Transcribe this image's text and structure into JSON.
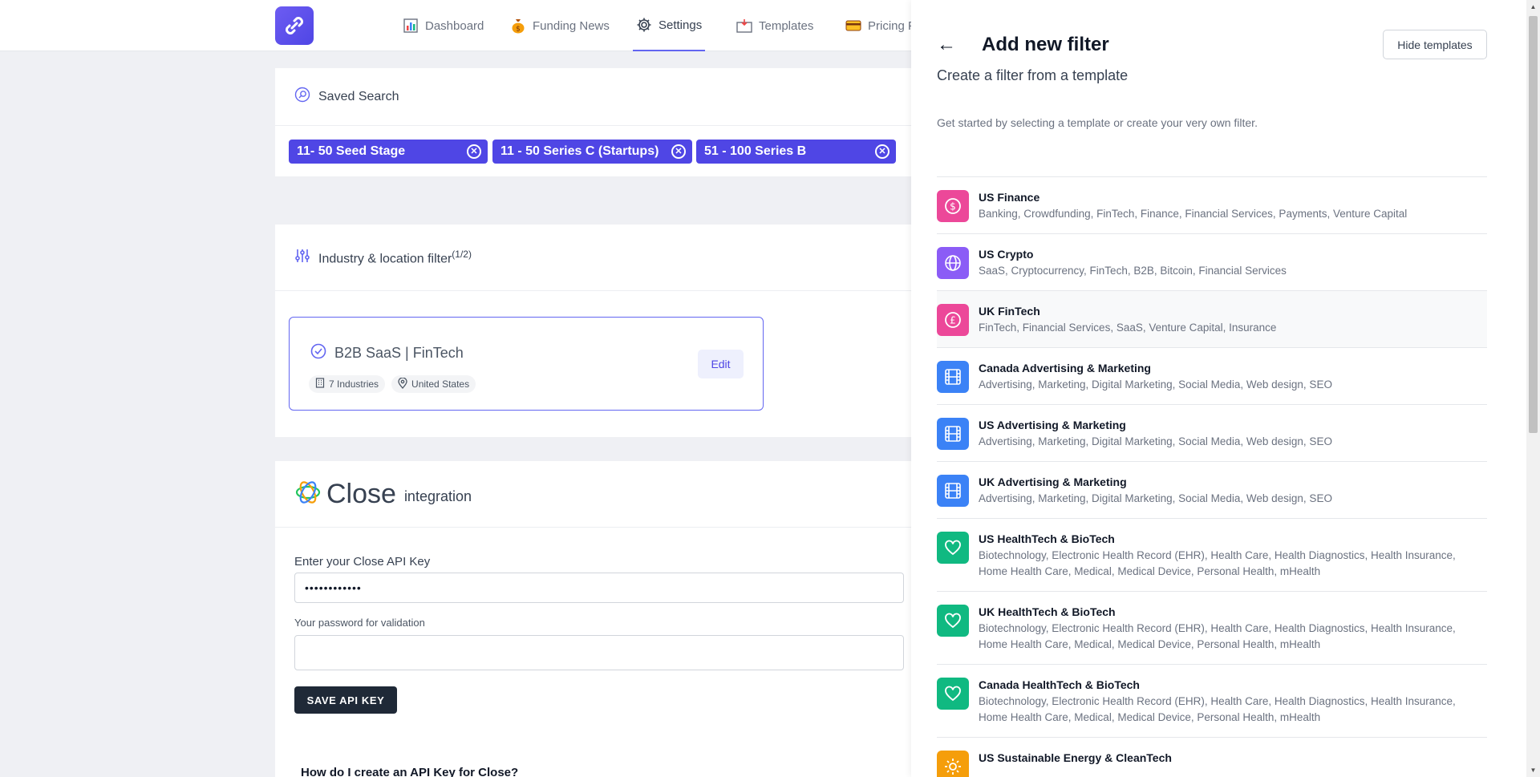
{
  "nav": {
    "items": [
      {
        "label": "Dashboard",
        "icon": "chart-icon"
      },
      {
        "label": "Funding News",
        "icon": "money-bag-icon"
      },
      {
        "label": "Settings",
        "icon": "gear-icon"
      },
      {
        "label": "Templates",
        "icon": "template-icon"
      },
      {
        "label": "Pricing P",
        "icon": "credit-card-icon"
      }
    ]
  },
  "saved_search": {
    "title": "Saved Search",
    "chips": [
      "11- 50 Seed Stage",
      "11 - 50 Series C (Startups)",
      "51 - 100 Series B"
    ]
  },
  "industry": {
    "title": "Industry & location filter",
    "count": "(1/2)",
    "filter_name": "B2B SaaS | FinTech",
    "industries": "7 Industries",
    "location": "United States",
    "edit_label": "Edit"
  },
  "close": {
    "brand": "Close",
    "suffix": "integration",
    "api_label": "Enter your Close API Key",
    "api_value": "••••••••••••",
    "password_label": "Your password for validation",
    "save_label": "SAVE API KEY",
    "howto": "How do I create an API Key for Close?"
  },
  "drawer": {
    "back": "←",
    "title": "Add new filter",
    "hide_label": "Hide templates",
    "subtitle": "Create a filter from a template",
    "description": "Get started by selecting a template or create your very own filter.",
    "templates": [
      {
        "name": "US Finance",
        "tags": "Banking, Crowdfunding, FinTech, Finance, Financial Services, Payments, Venture Capital",
        "icon": "dollar-icon",
        "color": "#ec4899"
      },
      {
        "name": "US Crypto",
        "tags": "SaaS, Cryptocurrency, FinTech, B2B, Bitcoin, Financial Services",
        "icon": "globe-icon",
        "color": "#8b5cf6"
      },
      {
        "name": "UK FinTech",
        "tags": "FinTech, Financial Services, SaaS, Venture Capital, Insurance",
        "icon": "pound-icon",
        "color": "#ec4899"
      },
      {
        "name": "Canada Advertising & Marketing",
        "tags": "Advertising, Marketing, Digital Marketing, Social Media, Web design, SEO",
        "icon": "film-icon",
        "color": "#3b82f6"
      },
      {
        "name": "US Advertising & Marketing",
        "tags": "Advertising, Marketing, Digital Marketing, Social Media, Web design, SEO",
        "icon": "film-icon",
        "color": "#3b82f6"
      },
      {
        "name": "UK Advertising & Marketing",
        "tags": "Advertising, Marketing, Digital Marketing, Social Media, Web design, SEO",
        "icon": "film-icon",
        "color": "#3b82f6"
      },
      {
        "name": "US HealthTech & BioTech",
        "tags": "Biotechnology, Electronic Health Record (EHR), Health Care, Health Diagnostics, Health Insurance, Home Health Care, Medical, Medical Device, Personal Health, mHealth",
        "icon": "heart-icon",
        "color": "#10b981"
      },
      {
        "name": "UK HealthTech & BioTech",
        "tags": "Biotechnology, Electronic Health Record (EHR), Health Care, Health Diagnostics, Health Insurance, Home Health Care, Medical, Medical Device, Personal Health, mHealth",
        "icon": "heart-icon",
        "color": "#10b981"
      },
      {
        "name": "Canada HealthTech & BioTech",
        "tags": "Biotechnology, Electronic Health Record (EHR), Health Care, Health Diagnostics, Health Insurance, Home Health Care, Medical, Medical Device, Personal Health, mHealth",
        "icon": "heart-icon",
        "color": "#10b981"
      },
      {
        "name": "US Sustainable Energy & CleanTech",
        "tags": "",
        "icon": "sun-icon",
        "color": "#f59e0b"
      }
    ]
  }
}
